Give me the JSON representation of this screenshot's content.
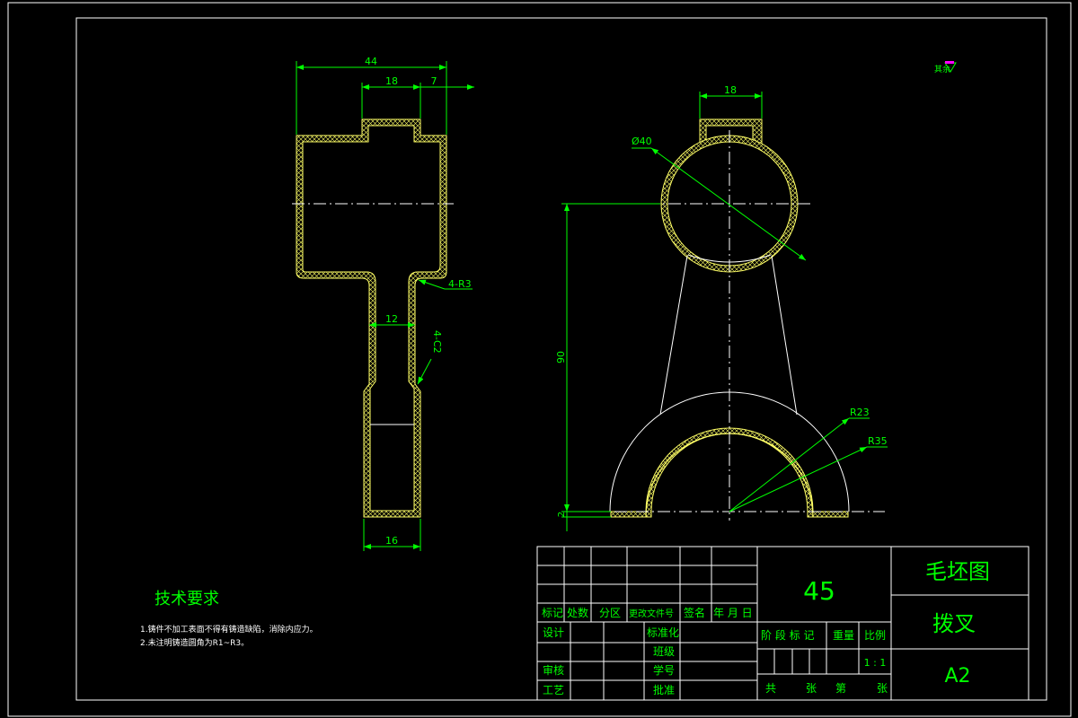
{
  "left_view": {
    "dims": {
      "overall_width": "44",
      "top_boss_width": "18",
      "right_offset": "7",
      "neck_width": "12",
      "bottom_width": "16",
      "fillet_note": "4-R3",
      "chamfer_note": "4-C2"
    }
  },
  "right_view": {
    "dims": {
      "boss_width": "18",
      "bore_diameter": "Ø40",
      "center_distance": "90",
      "inner_radius": "R23",
      "outer_radius": "R35",
      "base_thickness": "2"
    }
  },
  "surface_mark": "其余",
  "tech_requirements": {
    "title": "技术要求",
    "items": [
      "1.铸件不加工表面不得有铸造缺陷，消除内应力。",
      "2.未注明铸造圆角为R1~R3。"
    ]
  },
  "title_block": {
    "material": "45",
    "drawing_type": "毛坯图",
    "part_name": "拨叉",
    "sheet_size": "A2",
    "scale": "1 : 1",
    "row_labels": {
      "mark": "标记",
      "count": "处数",
      "zone": "分区",
      "change_doc": "更改文件号",
      "signature": "签名",
      "date": "年 月 日"
    },
    "design": "设计",
    "standardize": "标准化",
    "class": "班级",
    "review": "审核",
    "student_no": "学号",
    "process": "工艺",
    "approve": "批准",
    "stage_mark": "阶 段 标 记",
    "weight": "重量",
    "ratio": "比例",
    "sheets_total": "共",
    "sheets_unit": "张",
    "sheet_no": "第",
    "sheet_unit2": "张"
  }
}
